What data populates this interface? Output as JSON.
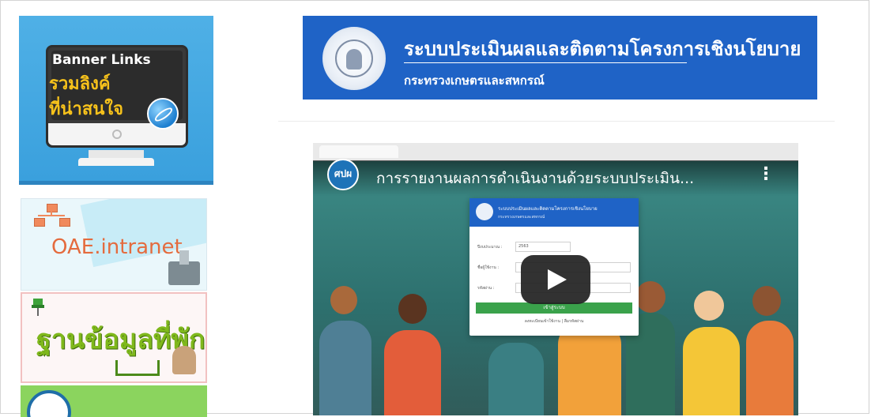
{
  "sidebar": {
    "banner_links": {
      "title": "Banner Links",
      "line1": "รวมลิงค์",
      "line2": "ที่น่าสนใจ"
    },
    "intranet": {
      "label": "OAE.intranet"
    },
    "residence": {
      "label": "ฐานข้อมูลที่พัก"
    }
  },
  "main_banner": {
    "title": "ระบบประเมินผลและติดตามโครงการเชิงนโยบาย",
    "subtitle": "กระทรวงเกษตรและสหกรณ์",
    "bg_color": "#1f63c6"
  },
  "video": {
    "channel_logo_text": "ศปผ",
    "title": "การรายงานผลการดำเนินงานด้วยระบบประเมิน...",
    "menu_glyph": "⋮",
    "login_card": {
      "header_title": "ระบบประเมินผลและติดตามโครงการเชิงนโยบาย",
      "header_subtitle": "กระทรวงเกษตรและสหกรณ์",
      "year_label": "ปีงบประมาณ :",
      "year_value": "2563",
      "username_label": "ชื่อผู้ใช้งาน :",
      "password_label": "รหัสผ่าน :",
      "login_button": "เข้าสู่ระบบ",
      "footer_link": "ลงทะเบียนเข้าใช้งาน | ลืมรหัสผ่าน"
    }
  },
  "colors": {
    "banner_links_bg": "#3aa0dd",
    "accent_yellow": "#f7c21b",
    "intranet_text": "#e46b3e",
    "residence_text": "#7fb81c",
    "video_bg": "#2e6b6a"
  }
}
